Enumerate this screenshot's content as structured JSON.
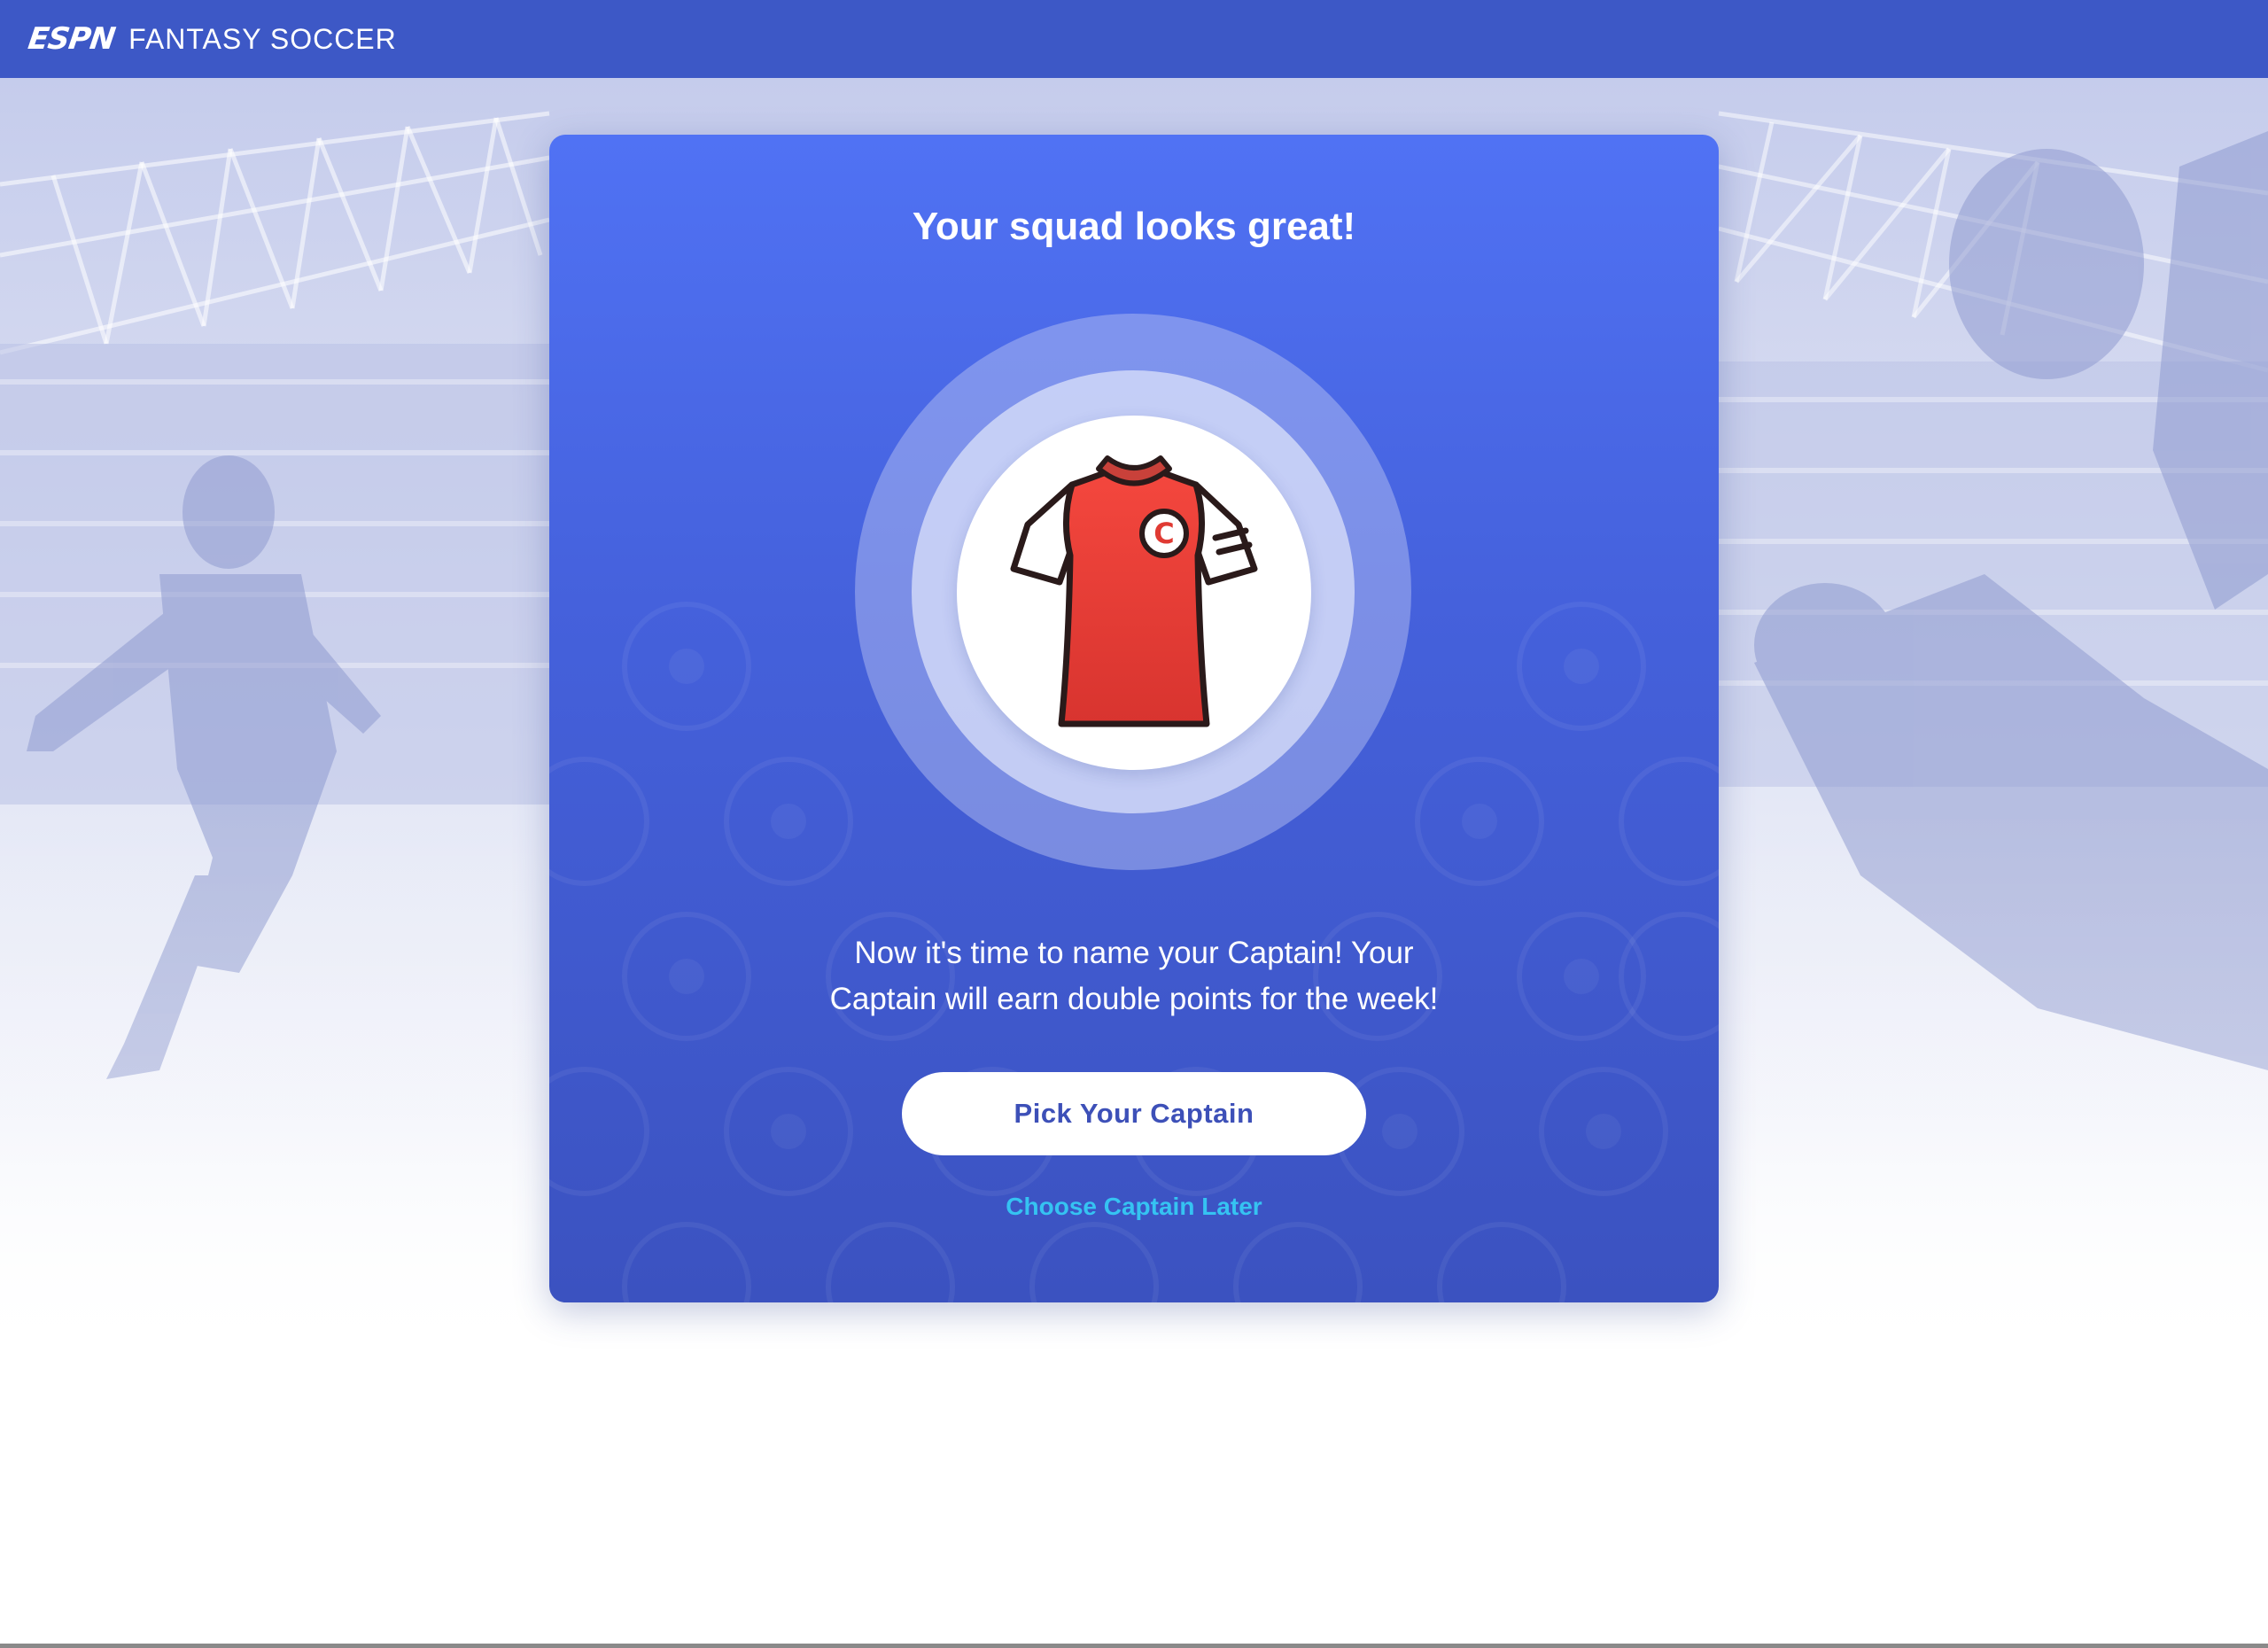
{
  "header": {
    "brand": "ESPN",
    "title": "FANTASY SOCCER",
    "background_color": "#3d58c6"
  },
  "hero": {
    "theme": "stadium-players-photo"
  },
  "card": {
    "title": "Your squad looks great!",
    "message_line1": "Now it's time to name your Captain! Your",
    "message_line2": "Captain will earn double points for the week!",
    "jersey_icon": "captain-jersey-icon",
    "jersey_letter": "C",
    "primary_button_label": "Pick Your Captain",
    "secondary_link_label": "Choose Captain Later",
    "gradient_top": "#5072f4",
    "gradient_bottom": "#3b52c0",
    "link_color": "#35c3f2",
    "button_text_color": "#3d50b8"
  }
}
